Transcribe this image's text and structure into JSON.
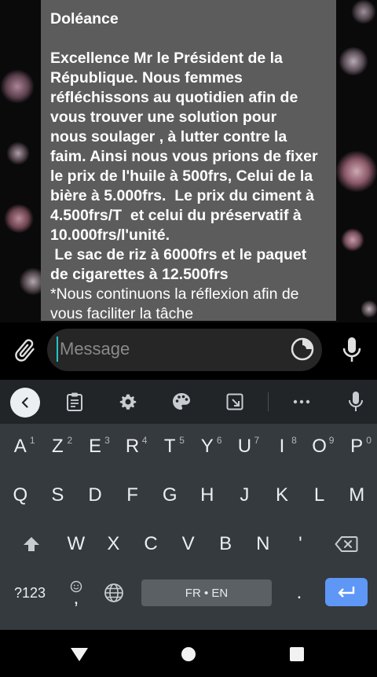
{
  "message": {
    "title": "Doléance",
    "lines_bold": [
      "Excellence Mr le Président de la",
      "République. Nous femmes",
      "réfléchissons au quotidien afin de",
      "vous trouver une solution pour",
      "nous soulager , à lutter contre la",
      "faim. Ainsi nous vous prions de fixer",
      "le prix de l'huile à 500frs, Celui de la",
      "bière à 5.000frs.  Le prix du ciment à",
      "4.500frs/T  et celui du préservatif à",
      "10.000frs/l'unité.",
      " Le sac de riz à 6000frs et le paquet",
      "de cigarettes à 12.500frs"
    ],
    "lines_normal": [
      "*Nous continuons la réflexion afin de",
      "vous faciliter la tâche"
    ]
  },
  "composer": {
    "placeholder": "Message"
  },
  "keyboard": {
    "row1": [
      {
        "label": "A",
        "hint": "1"
      },
      {
        "label": "Z",
        "hint": "2"
      },
      {
        "label": "E",
        "hint": "3"
      },
      {
        "label": "R",
        "hint": "4"
      },
      {
        "label": "T",
        "hint": "5"
      },
      {
        "label": "Y",
        "hint": "6"
      },
      {
        "label": "U",
        "hint": "7"
      },
      {
        "label": "I",
        "hint": "8"
      },
      {
        "label": "O",
        "hint": "9"
      },
      {
        "label": "P",
        "hint": "0"
      }
    ],
    "row2": [
      "Q",
      "S",
      "D",
      "F",
      "G",
      "H",
      "J",
      "K",
      "L",
      "M"
    ],
    "row3": [
      "W",
      "X",
      "C",
      "V",
      "B",
      "N",
      "'"
    ],
    "symbols_label": "?123",
    "comma_label": ",",
    "space_label": "FR • EN",
    "period_label": "."
  },
  "colors": {
    "bubble": "#5c5c5c",
    "accent_enter": "#5e97f6",
    "caret": "#22c3c8"
  }
}
